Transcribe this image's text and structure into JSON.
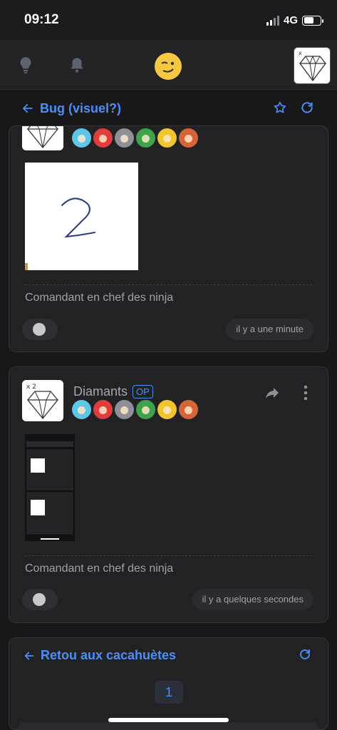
{
  "status_bar": {
    "time": "09:12",
    "network": "4G",
    "battery_level": 0.62
  },
  "nav": {
    "icons": [
      "lightbulb-icon",
      "bell-icon",
      "app-logo-icon",
      "user-avatar"
    ]
  },
  "thread": {
    "title": "Bug (visuel?)",
    "actions": [
      "star-icon",
      "refresh-icon"
    ]
  },
  "posts": [
    {
      "signature": "Comandant en chef des ninja",
      "timestamp": "il y a une minute",
      "image_text": "2"
    },
    {
      "author": "Diamants",
      "op_label": "OP",
      "signature": "Comandant en chef des ninja",
      "timestamp": "il y a quelques secondes"
    }
  ],
  "footer": {
    "back_label": "Retou aux cacahuètes",
    "page": "1"
  },
  "colors": {
    "accent": "#4a8ff5",
    "background": "#18181b",
    "card": "#222225"
  }
}
